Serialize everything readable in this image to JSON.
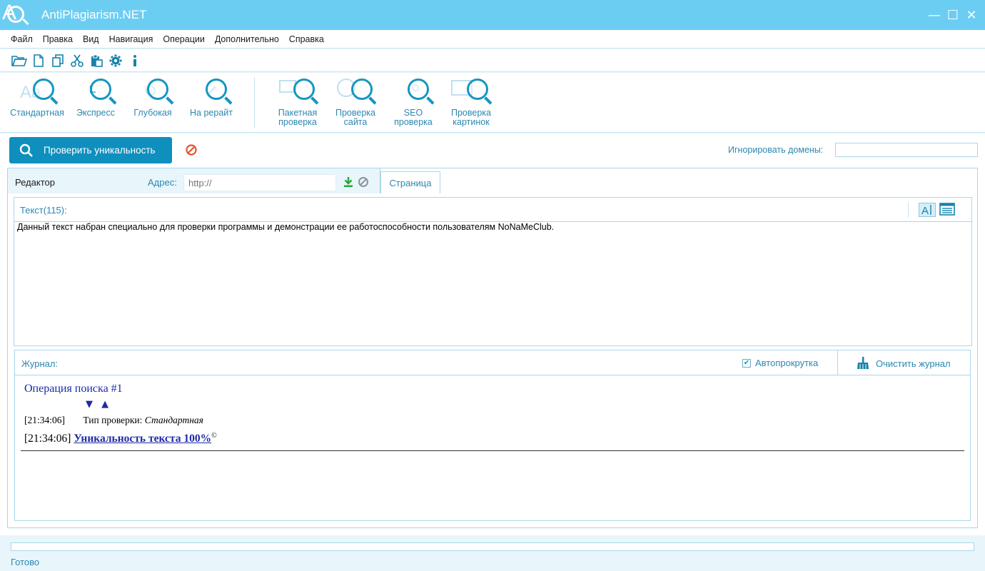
{
  "app": {
    "title": "AntiPlagiarism.NET",
    "logo_letter": "A"
  },
  "window_controls": {
    "minimize": "—",
    "maximize": "☐",
    "close": "✕"
  },
  "menu": {
    "items": [
      "Файл",
      "Правка",
      "Вид",
      "Навигация",
      "Операции",
      "Дополнительно",
      "Справка"
    ]
  },
  "quick_toolbar": {
    "icons": [
      "open-folder-icon",
      "new-file-icon",
      "copy-icon",
      "cut-icon",
      "paste-icon",
      "settings-gear-icon",
      "info-icon"
    ]
  },
  "ribbon": {
    "check_modes": [
      {
        "label": "Стандартная",
        "icon": "standard-check-icon"
      },
      {
        "label": "Экспресс",
        "icon": "express-check-icon"
      },
      {
        "label": "Глубокая",
        "icon": "deep-check-icon"
      },
      {
        "label": "На рерайт",
        "icon": "rewrite-check-icon"
      }
    ],
    "tools": [
      {
        "line1": "Пакетная",
        "line2": "проверка",
        "icon": "batch-check-icon"
      },
      {
        "line1": "Проверка",
        "line2": "сайта",
        "icon": "site-check-icon"
      },
      {
        "line1": "SEO",
        "line2": "проверка",
        "icon": "seo-check-icon"
      },
      {
        "line1": "Проверка",
        "line2": "картинок",
        "icon": "image-check-icon"
      }
    ]
  },
  "actions": {
    "check_button": "Проверить уникальность",
    "ignore_domains_label": "Игнорировать домены:",
    "ignore_domains_value": ""
  },
  "tabs": {
    "editor": "Редактор",
    "page": "Страница",
    "address_label": "Адрес:",
    "address_placeholder": "http://"
  },
  "editor": {
    "label": "Текст(115):",
    "text": "Данный текст набран специально для проверки программы и демонстрации ее работоспособности пользователям NoNaMeClub."
  },
  "journal": {
    "label": "Журнал:",
    "autoscroll_label": "Автопрокрутка",
    "autoscroll_checked": true,
    "clear_label": "Очистить журнал",
    "operation_title": "Операция поиска #1",
    "arrow_down": "▼",
    "arrow_up": "▲",
    "entry1_time": "[21:34:06]",
    "entry1_label": "Тип проверки:",
    "entry1_value": "Стандартная",
    "entry2_time": "[21:34:06]",
    "entry2_result": "Уникальность текста 100%",
    "entry2_sup": "©"
  },
  "status": {
    "text": "Готово",
    "progress": 0
  },
  "colors": {
    "title_bar": "#6ccdf3",
    "accent": "#1596c2",
    "button": "#0f8fbd",
    "link": "#1c2aa8"
  }
}
